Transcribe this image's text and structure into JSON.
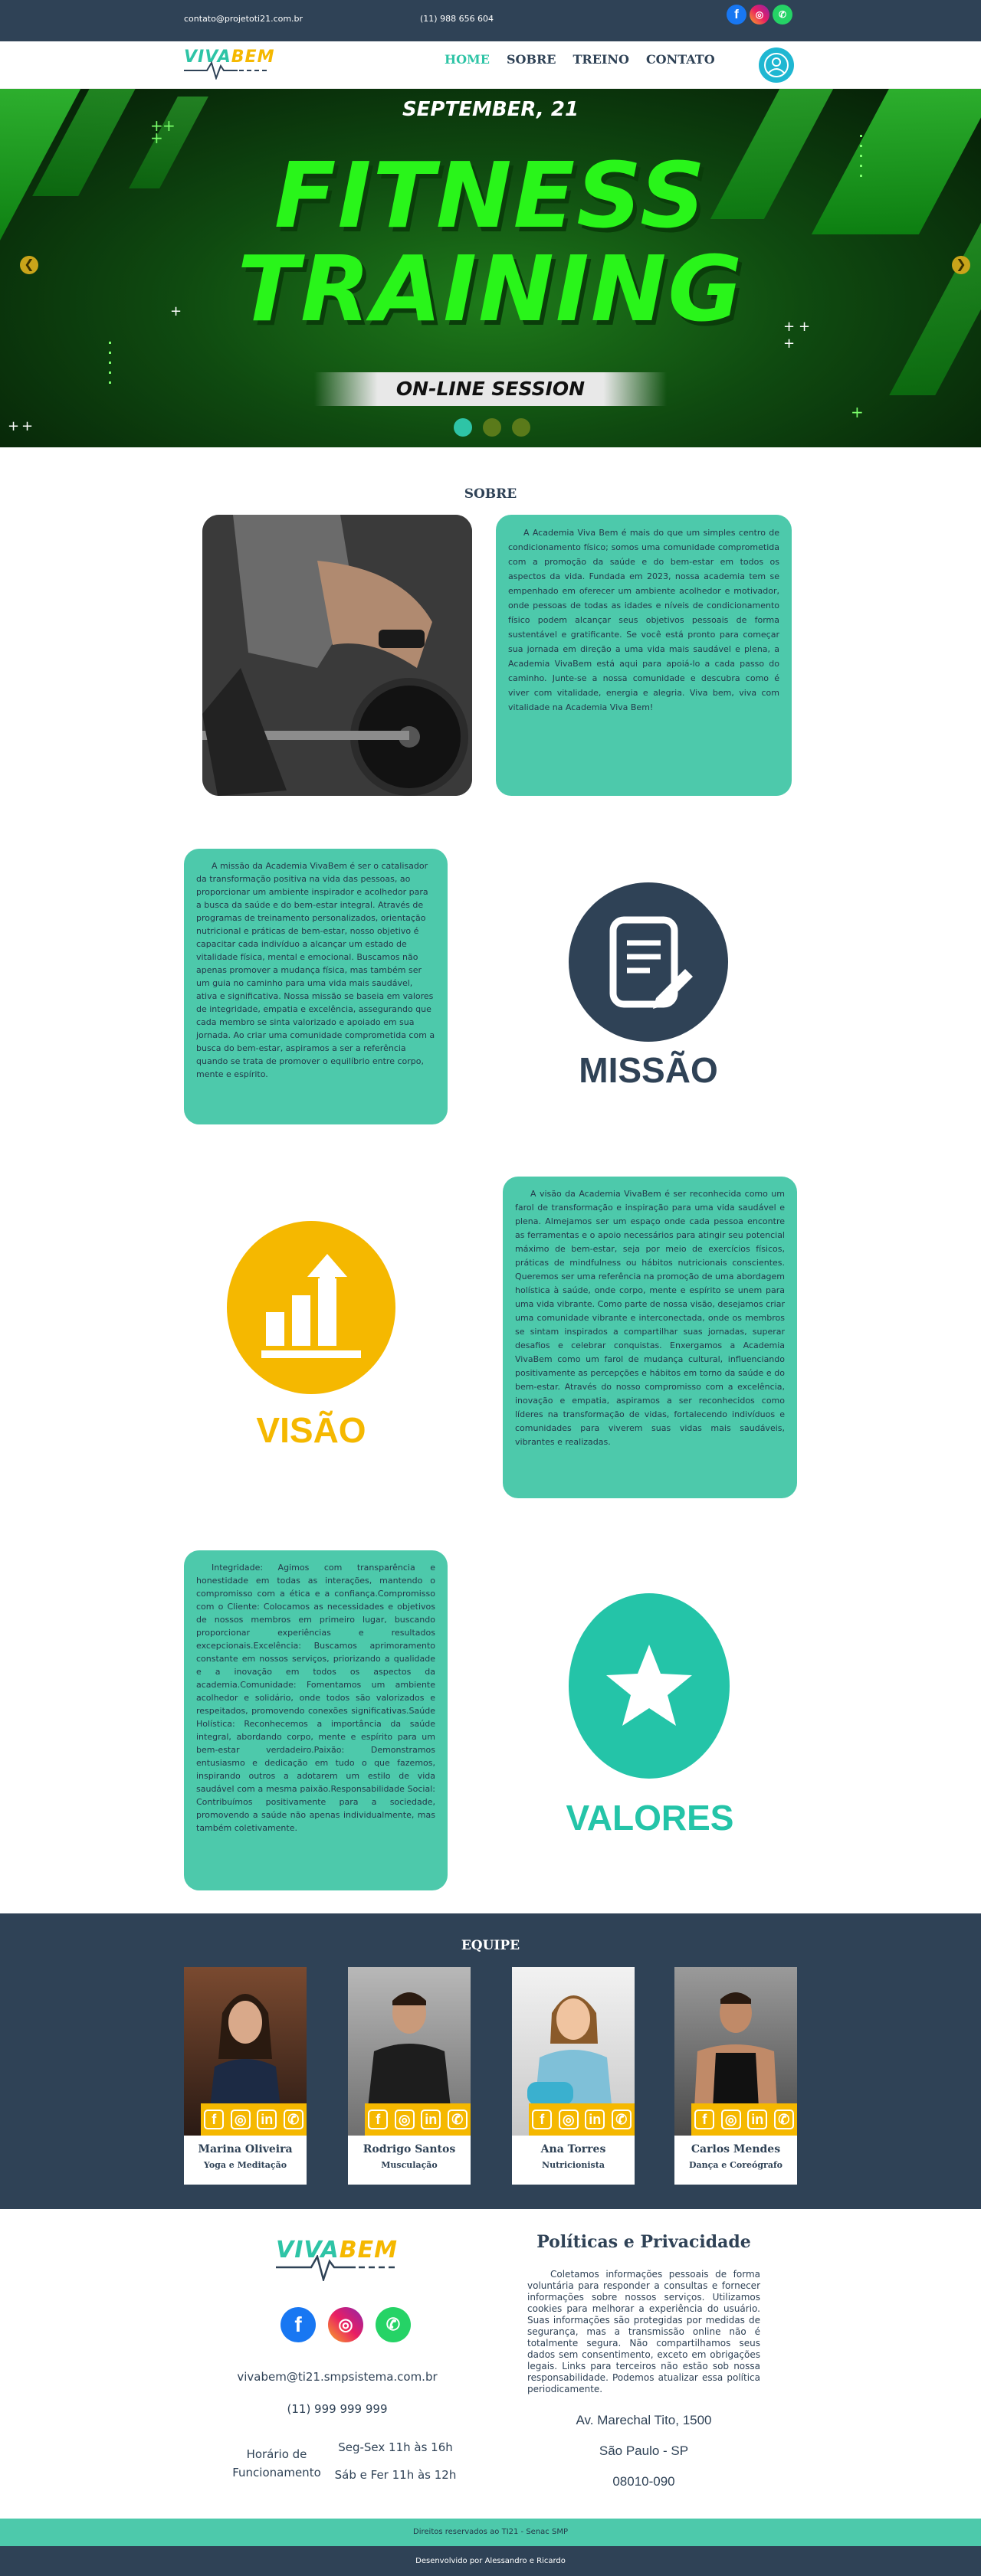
{
  "topbar": {
    "email": "contato@projetoti21.com.br",
    "phone": "(11) 988 656 604",
    "socials": [
      "facebook-icon",
      "instagram-icon",
      "whatsapp-icon"
    ]
  },
  "nav": {
    "logo_left": "VIVA",
    "logo_right": "BEM",
    "items": [
      "HOME",
      "SOBRE",
      "TREINO",
      "CONTATO"
    ]
  },
  "hero": {
    "date": "SEPTEMBER, 21",
    "title_line1": "FITNESS",
    "title_line2": "TRAINING",
    "subtitle": "ON-LINE SESSION",
    "prev": "❮",
    "next": "❯",
    "slides": 3,
    "active_slide": 0
  },
  "about": {
    "title": "SOBRE",
    "text": "A Academia Viva Bem é mais do que um simples centro de condicionamento físico; somos uma comunidade comprometida com a promoção da saúde e do bem-estar em todos os aspectos da vida. Fundada em 2023, nossa academia tem se empenhado em oferecer um ambiente acolhedor e motivador, onde pessoas de todas as idades e níveis de condicionamento físico podem alcançar seus objetivos pessoais de forma sustentável e gratificante. Se você está pronto para começar sua jornada em direção a uma vida mais saudável e plena, a Academia VivaBem está aqui para apoiá-lo a cada passo do caminho. Junte-se a nossa comunidade e descubra como é viver com vitalidade, energia e alegria. Viva bem, viva com vitalidade na Academia Viva Bem!"
  },
  "mission": {
    "label": "MISSÃO",
    "text": "A missão da Academia VivaBem é ser o catalisador da transformação positiva na vida das pessoas, ao proporcionar um ambiente inspirador e acolhedor para a busca da saúde e do bem-estar integral. Através de programas de treinamento personalizados, orientação nutricional e práticas de bem-estar, nosso objetivo é capacitar cada indivíduo a alcançar um estado de vitalidade física, mental e emocional. Buscamos não apenas promover a mudança física, mas também ser um guia no caminho para uma vida mais saudável, ativa e significativa. Nossa missão se baseia em valores de integridade, empatia e excelência, assegurando que cada membro se sinta valorizado e apoiado em sua jornada. Ao criar uma comunidade comprometida com a busca do bem-estar, aspiramos a ser a referência quando se trata de promover o equilíbrio entre corpo, mente e espírito."
  },
  "vision": {
    "label": "VISÃO",
    "text": "A visão da Academia VivaBem é ser reconhecida como um farol de transformação e inspiração para uma vida saudável e plena. Almejamos ser um espaço onde cada pessoa encontre as ferramentas e o apoio necessários para atingir seu potencial máximo de bem-estar, seja por meio de exercícios físicos, práticas de mindfulness ou hábitos nutricionais conscientes. Queremos ser uma referência na promoção de uma abordagem holística à saúde, onde corpo, mente e espírito se unem para uma vida vibrante. Como parte de nossa visão, desejamos criar uma comunidade vibrante e interconectada, onde os membros se sintam inspirados a compartilhar suas jornadas, superar desafios e celebrar conquistas. Enxergamos a Academia VivaBem como um farol de mudança cultural, influenciando positivamente as percepções e hábitos em torno da saúde e do bem-estar. Através do nosso compromisso com a excelência, inovação e empatia, aspiramos a ser reconhecidos como líderes na transformação de vidas, fortalecendo indivíduos e comunidades para viverem suas vidas mais saudáveis, vibrantes e realizadas."
  },
  "values": {
    "label": "VALORES",
    "text": "Integridade: Agimos com transparência e honestidade em todas as interações, mantendo o compromisso com a ética e a confiança.Compromisso com o Cliente: Colocamos as necessidades e objetivos de nossos membros em primeiro lugar, buscando proporcionar experiências e resultados excepcionais.Excelência: Buscamos aprimoramento constante em nossos serviços, priorizando a qualidade e a inovação em todos os aspectos da academia.Comunidade: Fomentamos um ambiente acolhedor e solidário, onde todos são valorizados e respeitados, promovendo conexões significativas.Saúde Holística: Reconhecemos a importância da saúde integral, abordando corpo, mente e espírito para um bem-estar verdadeiro.Paixão: Demonstramos entusiasmo e dedicação em tudo o que fazemos, inspirando outros a adotarem um estilo de vida saudável com a mesma paixão.Responsabilidade Social: Contribuímos positivamente para a sociedade, promovendo a saúde não apenas individualmente, mas também coletivamente."
  },
  "team": {
    "title": "EQUIPE",
    "members": [
      {
        "name": "Marina Oliveira",
        "role": "Yoga e Meditação"
      },
      {
        "name": "Rodrigo Santos",
        "role": "Musculação"
      },
      {
        "name": "Ana Torres",
        "role": "Nutricionista"
      },
      {
        "name": "Carlos Mendes",
        "role": "Dança e Coreógrafo"
      }
    ],
    "social_glyphs": [
      "f",
      "◎",
      "in",
      "✆"
    ]
  },
  "footer": {
    "email": "vivabem@ti21.smpsistema.com.br",
    "phone": "(11) 999 999 999",
    "hours_label_1": "Horário de",
    "hours_label_2": "Funcionamento",
    "hours_1": "Seg-Sex 11h às 16h",
    "hours_2": "Sáb e Fer 11h às 12h",
    "policy_title": "Políticas e Privacidade",
    "policy_text": "Coletamos informações pessoais de forma voluntária para responder a consultas e fornecer informações sobre nossos serviços. Utilizamos cookies para melhorar a experiência do usuário. Suas informações são protegidas por medidas de segurança, mas a transmissão online não é totalmente segura. Não compartilhamos seus dados sem consentimento, exceto em obrigações legais. Links para terceiros não estão sob nossa responsabilidade. Podemos atualizar essa política periodicamente.",
    "address": "Av. Marechal Tito, 1500",
    "city": "São Paulo - SP",
    "zip": "08010-090",
    "rights": "Direitos reservados ao TI21 - Senac SMP",
    "dev": "Desenvolvido por Alessandro e Ricardo"
  },
  "colors": {
    "navy": "#2f4256",
    "teal": "#4dc9ab",
    "yellow": "#f5b800",
    "green": "#29f51a"
  }
}
